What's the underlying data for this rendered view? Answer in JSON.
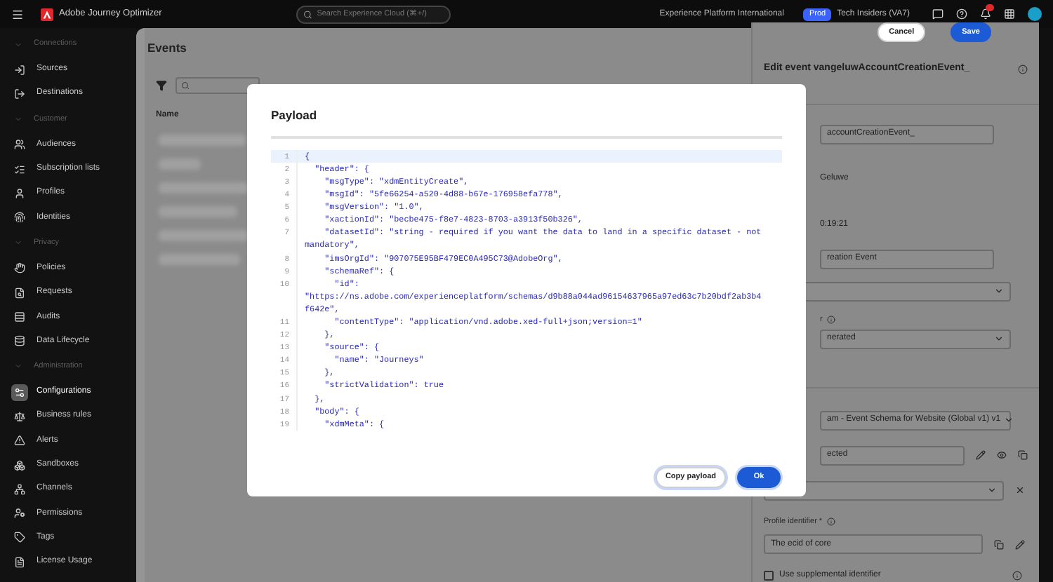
{
  "top_bar": {
    "app_name": "Adobe Journey Optimizer",
    "search": {
      "placeholder": "Search Experience Cloud (⌘+/)"
    },
    "org": "Experience Platform International",
    "env_badge": "Prod",
    "sandbox": "Tech Insiders (VA7)"
  },
  "sidebar": {
    "sections": [
      {
        "title": "Connections",
        "expanded": true,
        "items": [
          {
            "label": "Sources",
            "selected": false
          },
          {
            "label": "Destinations",
            "selected": false
          }
        ]
      },
      {
        "title": "Customer",
        "expanded": true,
        "items": [
          {
            "label": "Audiences",
            "selected": false
          },
          {
            "label": "Subscription lists",
            "selected": false
          },
          {
            "label": "Profiles",
            "selected": false
          },
          {
            "label": "Identities",
            "selected": false
          }
        ]
      },
      {
        "title": "Privacy",
        "expanded": true,
        "items": [
          {
            "label": "Policies",
            "selected": false
          },
          {
            "label": "Requests",
            "selected": false
          },
          {
            "label": "Audits",
            "selected": false
          },
          {
            "label": "Data Lifecycle",
            "selected": false
          }
        ]
      },
      {
        "title": "Administration",
        "expanded": true,
        "items": [
          {
            "label": "Configurations",
            "selected": true
          },
          {
            "label": "Business rules",
            "selected": false
          },
          {
            "label": "Alerts",
            "selected": false
          },
          {
            "label": "Sandboxes",
            "selected": false
          },
          {
            "label": "Channels",
            "selected": false
          },
          {
            "label": "Permissions",
            "selected": false
          },
          {
            "label": "Tags",
            "selected": false
          },
          {
            "label": "License Usage",
            "selected": false
          }
        ]
      }
    ]
  },
  "events_panel": {
    "title": "Events",
    "columns": [
      "Name"
    ]
  },
  "edit_panel": {
    "buttons": [
      {
        "label": "Cancel",
        "kind": "secondary"
      },
      {
        "label": "Save",
        "kind": "primary"
      }
    ],
    "title": "Edit event vangeluwAccountCreationEvent_",
    "sections": [
      {
        "fields": [
          {
            "kind": "input",
            "value": "accountCreationEvent_",
            "clipped": true
          },
          {
            "kind": "text",
            "value": "Geluwe",
            "clipped": true
          },
          {
            "kind": "text",
            "value": "0:19:21",
            "clipped": true
          },
          {
            "kind": "input",
            "value": "reation Event",
            "clipped": true
          },
          {
            "kind": "select",
            "clipped": false
          },
          {
            "kind": "label",
            "value": "r",
            "clipped": true
          },
          {
            "kind": "select",
            "value": "nerated",
            "clipped": true
          }
        ]
      },
      {
        "fields": [
          {
            "kind": "select",
            "value": "am - Event Schema for Website (Global v1) v1",
            "clipped": true
          },
          {
            "kind": "input_tools",
            "value": "ected",
            "clipped": true
          },
          {
            "kind": "select_clear",
            "clipped": false
          },
          {
            "kind": "label",
            "value": "Profile identifier *",
            "clipped": false
          },
          {
            "kind": "input_copy_edit",
            "value": "The ecid of core",
            "clipped": false
          },
          {
            "kind": "checkbox",
            "value": "Use supplemental identifier",
            "checked": false,
            "clipped": false
          }
        ]
      }
    ]
  },
  "dialog": {
    "title": "Payload",
    "code_lines": [
      {
        "number": "1",
        "segments": [
          "{"
        ],
        "highlighted": true
      },
      {
        "number": "2",
        "segments": [
          "  \"header\": {"
        ],
        "highlighted": false
      },
      {
        "number": "3",
        "segments": [
          "    \"msgType\": \"xdmEntityCreate\","
        ],
        "highlighted": false
      },
      {
        "number": "4",
        "segments": [
          "    \"msgId\": \"5fe66254-a520-4d88-b67e-176958efa778\","
        ],
        "highlighted": false
      },
      {
        "number": "5",
        "segments": [
          "    \"msgVersion\": \"1.0\","
        ],
        "highlighted": false
      },
      {
        "number": "6",
        "segments": [
          "    \"xactionId\": \"becbe475-f8e7-4823-8703-a3913f50b326\","
        ],
        "highlighted": false
      },
      {
        "number": "7",
        "segments": [
          "    \"datasetId\": \"string - required if you want the data to land in a specific dataset - not",
          "mandatory\","
        ],
        "highlighted": false
      },
      {
        "number": "8",
        "segments": [
          "    \"imsOrgId\": \"907075E95BF479EC0A495C73@AdobeOrg\","
        ],
        "highlighted": false
      },
      {
        "number": "9",
        "segments": [
          "    \"schemaRef\": {"
        ],
        "highlighted": false
      },
      {
        "number": "10",
        "segments": [
          "      \"id\":",
          "\"https://ns.adobe.com/experienceplatform/schemas/d9b88a044ad96154637965a97ed63c7b20bdf2ab3b4",
          "f642e\","
        ],
        "highlighted": false
      },
      {
        "number": "11",
        "segments": [
          "      \"contentType\": \"application/vnd.adobe.xed-full+json;version=1\""
        ],
        "highlighted": false
      },
      {
        "number": "12",
        "segments": [
          "    },"
        ],
        "highlighted": false
      },
      {
        "number": "13",
        "segments": [
          "    \"source\": {"
        ],
        "highlighted": false
      },
      {
        "number": "14",
        "segments": [
          "      \"name\": \"Journeys\""
        ],
        "highlighted": false
      },
      {
        "number": "15",
        "segments": [
          "    },"
        ],
        "highlighted": false
      },
      {
        "number": "16",
        "segments": [
          "    \"strictValidation\": true"
        ],
        "highlighted": false
      },
      {
        "number": "17",
        "segments": [
          "  },"
        ],
        "highlighted": false
      },
      {
        "number": "18",
        "segments": [
          "  \"body\": {"
        ],
        "highlighted": false
      },
      {
        "number": "19",
        "segments": [
          "    \"xdmMeta\": {"
        ],
        "highlighted": false
      }
    ],
    "buttons": [
      {
        "label": "Copy payload",
        "kind": "secondary"
      },
      {
        "label": "Ok",
        "kind": "primary"
      }
    ]
  }
}
